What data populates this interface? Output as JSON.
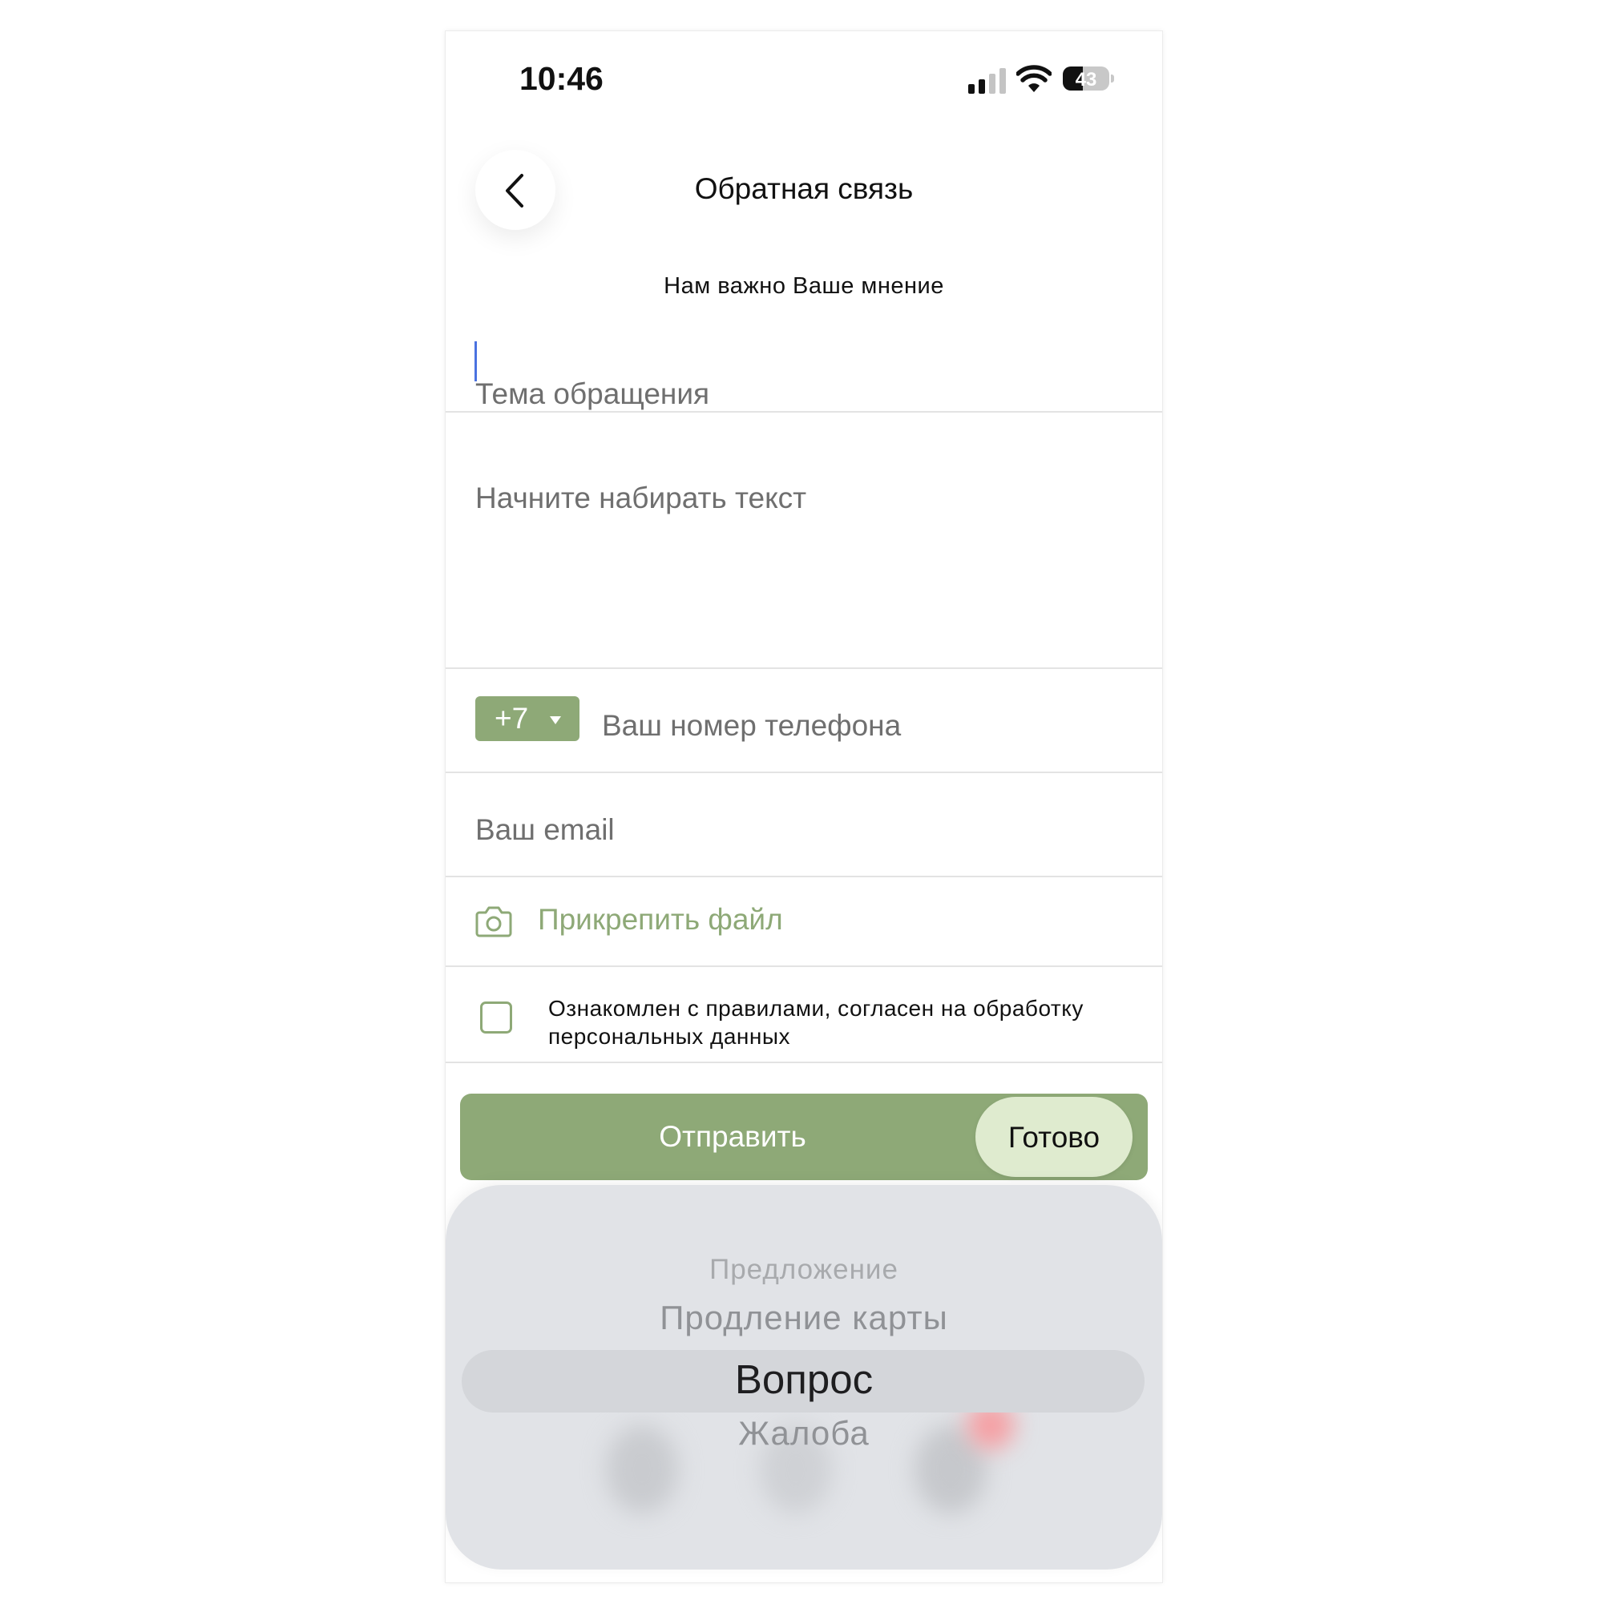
{
  "status_bar": {
    "time": "10:46",
    "battery_level": "43"
  },
  "header": {
    "back_icon": "chevron-left-icon",
    "title": "Обратная связь",
    "subtitle": "Нам важно Ваше мнение"
  },
  "form": {
    "subject_placeholder": "Тема обращения",
    "message_placeholder": "Начните набирать текст",
    "country_code": "+7",
    "phone_placeholder": "Ваш номер телефона",
    "email_placeholder": "Ваш email",
    "attach_icon": "camera-icon",
    "attach_label": "Прикрепить файл",
    "consent_checked": false,
    "consent_text": "Ознакомлен с правилами, согласен на обработку персональных данных",
    "submit_label": "Отправить"
  },
  "picker": {
    "done_label": "Готово",
    "items": [
      "Предложение",
      "Продление карты",
      "Вопрос",
      "Жалоба"
    ],
    "selected": "Вопрос"
  },
  "colors": {
    "accent": "#8ea977",
    "done_button": "#dfebcf",
    "picker_bg": "#e1e3e7",
    "caret": "#4a72e0"
  }
}
